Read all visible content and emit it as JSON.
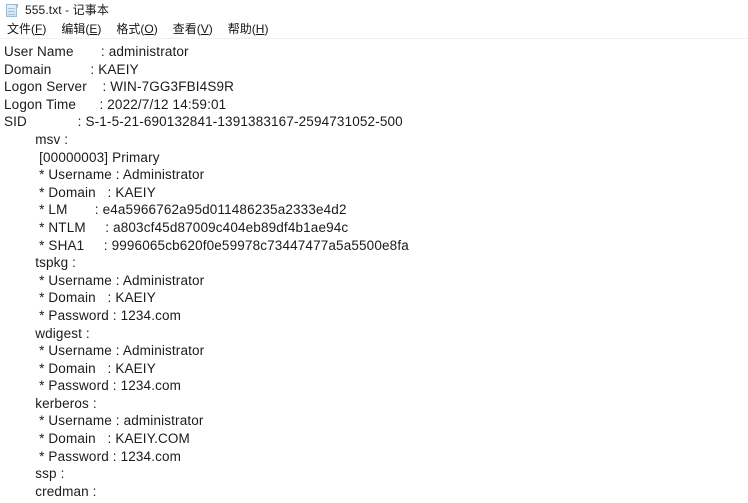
{
  "window": {
    "title": "555.txt - 记事本",
    "icon": "notepad-document-icon"
  },
  "menubar": {
    "items": [
      {
        "label": "文件",
        "accel": "F",
        "full": "文件(F)"
      },
      {
        "label": "编辑",
        "accel": "E",
        "full": "编辑(E)"
      },
      {
        "label": "格式",
        "accel": "O",
        "full": "格式(O)"
      },
      {
        "label": "查看",
        "accel": "V",
        "full": "查看(V)"
      },
      {
        "label": "帮助",
        "accel": "H",
        "full": "帮助(H)"
      }
    ]
  },
  "document": {
    "filename": "555.txt",
    "fields": {
      "user_name": "administrator",
      "domain": "KAEIY",
      "logon_server": "WIN-7GG3FBI4S9R",
      "logon_time": "2022/7/12 14:59:01",
      "sid": "S-1-5-21-690132841-1391383167-2594731052-500"
    },
    "packages": {
      "msv": {
        "entry": "[00000003] Primary",
        "username": "Administrator",
        "domain": "KAEIY",
        "lm": "e4a5966762a95d011486235a2333e4d2",
        "ntlm": "a803cf45d87009c404eb89df4b1ae94c",
        "sha1": "9996065cb620f0e59978c73447477a5a5500e8fa"
      },
      "tspkg": {
        "username": "Administrator",
        "domain": "KAEIY",
        "password": "1234.com"
      },
      "wdigest": {
        "username": "Administrator",
        "domain": "KAEIY",
        "password": "1234.com"
      },
      "kerberos": {
        "username": "administrator",
        "domain": "KAEIY.COM",
        "password": "1234.com"
      },
      "ssp": "",
      "credman": ""
    },
    "lines": [
      "User Name       : administrator",
      "Domain          : KAEIY",
      "Logon Server    : WIN-7GG3FBI4S9R",
      "Logon Time      : 2022/7/12 14:59:01",
      "SID             : S-1-5-21-690132841-1391383167-2594731052-500",
      "        msv :",
      "         [00000003] Primary",
      "         * Username : Administrator",
      "         * Domain   : KAEIY",
      "         * LM       : e4a5966762a95d011486235a2333e4d2",
      "         * NTLM     : a803cf45d87009c404eb89df4b1ae94c",
      "         * SHA1     : 9996065cb620f0e59978c73447477a5a5500e8fa",
      "        tspkg :",
      "         * Username : Administrator",
      "         * Domain   : KAEIY",
      "         * Password : 1234.com",
      "        wdigest :",
      "         * Username : Administrator",
      "         * Domain   : KAEIY",
      "         * Password : 1234.com",
      "        kerberos :",
      "         * Username : administrator",
      "         * Domain   : KAEIY.COM",
      "         * Password : 1234.com",
      "        ssp :",
      "        credman :"
    ]
  },
  "colors": {
    "window_bg": "#ffffff",
    "text": "#1b1b1b",
    "menu_divider": "#f1f1f1",
    "icon_fill": "#cfe0ee",
    "icon_stroke": "#9dbdd6"
  }
}
